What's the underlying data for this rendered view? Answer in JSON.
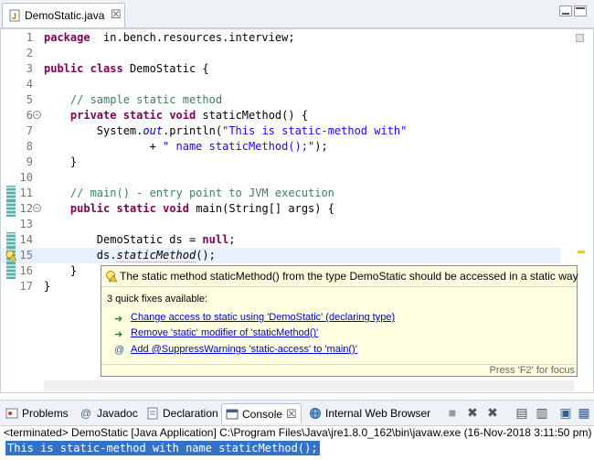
{
  "editor_tab": {
    "label": "DemoStatic.java",
    "close": "☒",
    "icon": "java-file-icon"
  },
  "code_lines": [
    {
      "num": "1",
      "tokens": [
        [
          "kw",
          "package"
        ],
        [
          "",
          "  in.bench.resources.interview;"
        ]
      ]
    },
    {
      "num": "2",
      "tokens": []
    },
    {
      "num": "3",
      "tokens": [
        [
          "kw",
          "public"
        ],
        [
          "",
          " "
        ],
        [
          "kw",
          "class"
        ],
        [
          "",
          " DemoStatic {"
        ]
      ]
    },
    {
      "num": "4",
      "tokens": []
    },
    {
      "num": "5",
      "tokens": [
        [
          "",
          "    "
        ],
        [
          "cm",
          "// sample static method"
        ]
      ]
    },
    {
      "num": "6",
      "tokens": [
        [
          "",
          "    "
        ],
        [
          "kw",
          "private"
        ],
        [
          "",
          " "
        ],
        [
          "kw",
          "static"
        ],
        [
          "",
          " "
        ],
        [
          "kw",
          "void"
        ],
        [
          "",
          " staticMethod() {"
        ]
      ]
    },
    {
      "num": "7",
      "tokens": [
        [
          "",
          "        System."
        ],
        [
          "fld",
          "out"
        ],
        [
          "",
          ".println("
        ],
        [
          "st",
          "\"This is static-method with\""
        ]
      ]
    },
    {
      "num": "8",
      "tokens": [
        [
          "",
          "                + "
        ],
        [
          "st",
          "\" name staticMethod();\""
        ],
        [
          "",
          ");"
        ]
      ]
    },
    {
      "num": "9",
      "tokens": [
        [
          "",
          "    }"
        ]
      ]
    },
    {
      "num": "10",
      "tokens": []
    },
    {
      "num": "11",
      "tokens": [
        [
          "",
          "    "
        ],
        [
          "cm",
          "// main() - entry point to JVM execution"
        ]
      ]
    },
    {
      "num": "12",
      "tokens": [
        [
          "",
          "    "
        ],
        [
          "kw",
          "public"
        ],
        [
          "",
          " "
        ],
        [
          "kw",
          "static"
        ],
        [
          "",
          " "
        ],
        [
          "kw",
          "void"
        ],
        [
          "",
          " main(String[] args) {"
        ]
      ]
    },
    {
      "num": "13",
      "tokens": []
    },
    {
      "num": "14",
      "tokens": [
        [
          "",
          "        DemoStatic ds = "
        ],
        [
          "kw",
          "null"
        ],
        [
          "",
          ";"
        ]
      ]
    },
    {
      "num": "15",
      "tokens": [
        [
          "",
          "        ds."
        ],
        [
          "itl warn-ul",
          "staticMethod"
        ],
        [
          "",
          "();"
        ]
      ]
    },
    {
      "num": "16",
      "tokens": [
        [
          "",
          "    }"
        ]
      ]
    },
    {
      "num": "17",
      "tokens": [
        [
          "",
          "}"
        ]
      ]
    }
  ],
  "quickfix": {
    "header": "The static method staticMethod() from the type DemoStatic should be accessed in a static way",
    "count": "3 quick fixes available:",
    "items": [
      {
        "icon": "change-icon",
        "label": "Change access to static using 'DemoStatic' (declaring type)"
      },
      {
        "icon": "change-icon",
        "label": "Remove 'static' modifier of 'staticMethod()'"
      },
      {
        "icon": "annotation-icon",
        "label": "Add @SuppressWarnings 'static-access' to 'main()'"
      }
    ],
    "footer": "Press 'F2' for focus"
  },
  "bottom_tabs": [
    {
      "label": "Problems",
      "icon": "problems-icon"
    },
    {
      "label": "Javadoc",
      "icon": "javadoc-icon"
    },
    {
      "label": "Declaration",
      "icon": "declaration-icon"
    },
    {
      "label": "Console",
      "icon": "console-icon",
      "close": "☒"
    },
    {
      "label": "Internal Web Browser",
      "icon": "globe-icon"
    }
  ],
  "console": {
    "terminated": "<terminated> DemoStatic [Java Application] C:\\Program Files\\Java\\jre1.8.0_162\\bin\\javaw.exe (16-Nov-2018 3:11:50 pm)",
    "output": "This is static-method with name staticMethod();"
  },
  "colors": {
    "keyword": "#7f0055",
    "comment": "#3f7f5f",
    "string": "#2a00ff",
    "field": "#0000c0",
    "selection": "#3372c7"
  }
}
